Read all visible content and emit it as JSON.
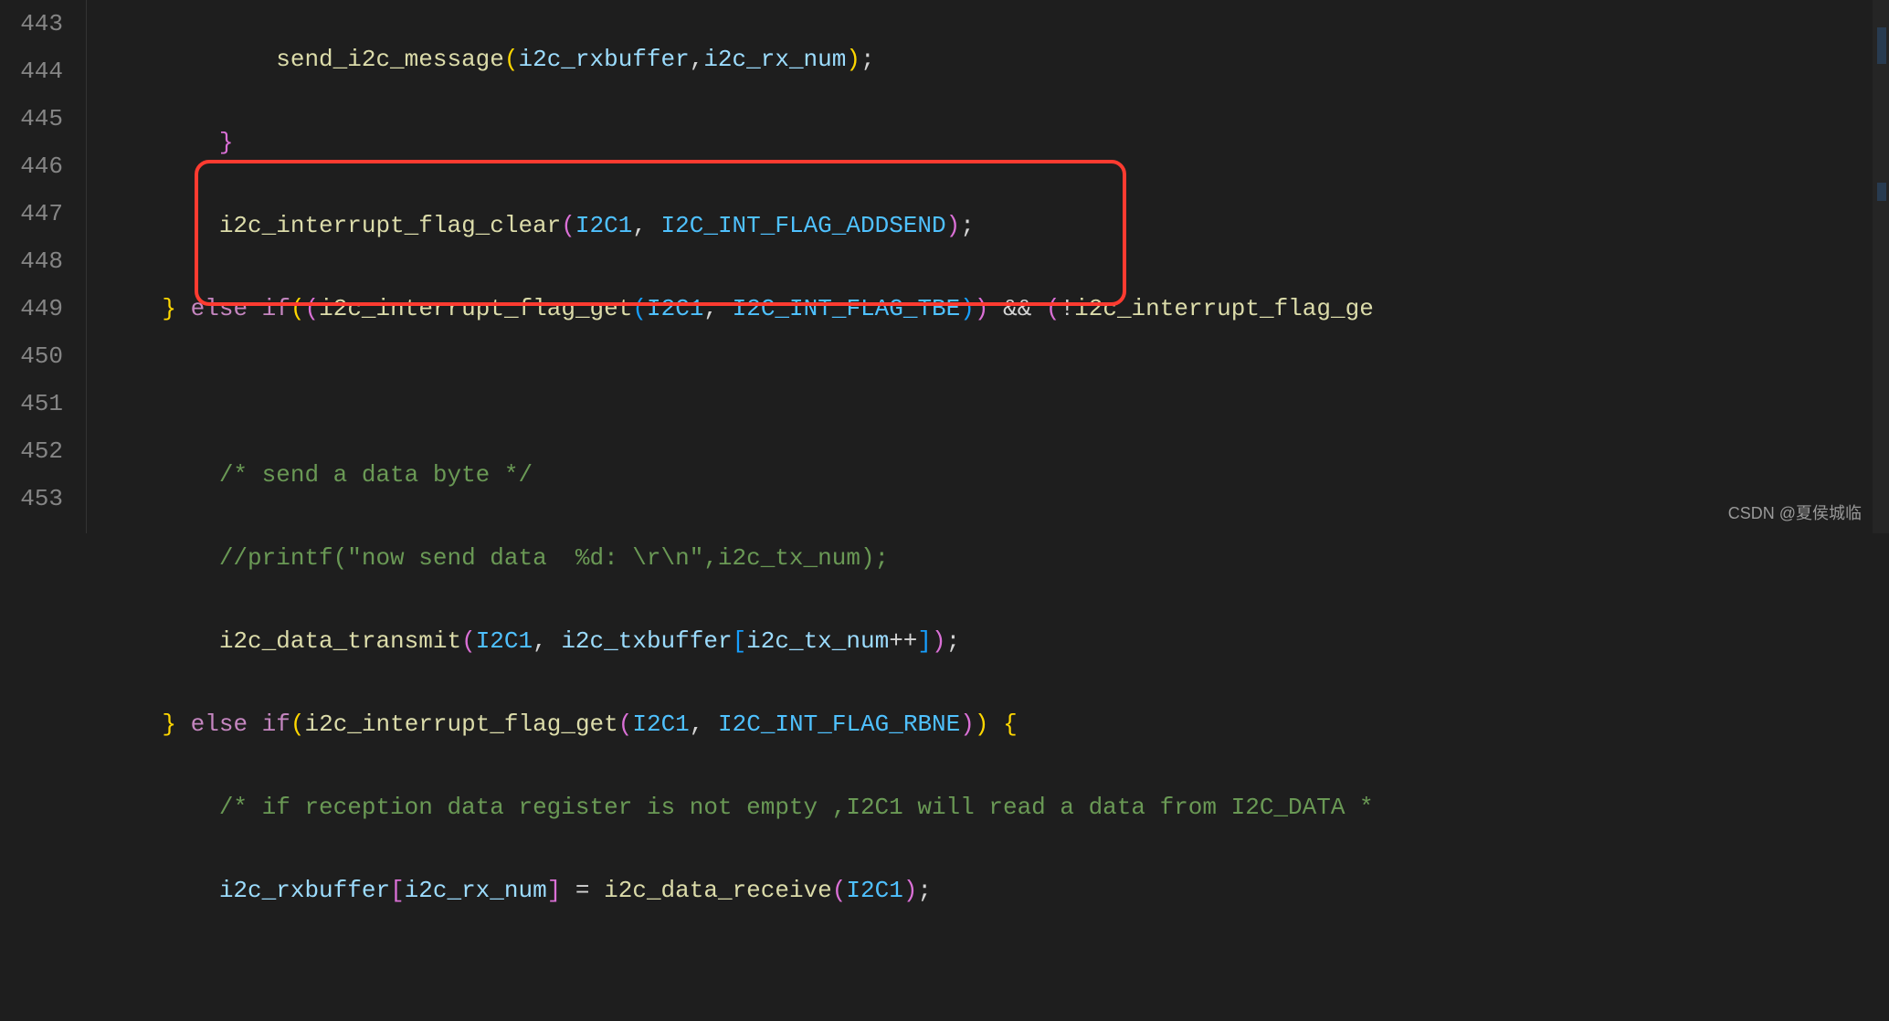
{
  "lines": {
    "443": "443",
    "444": "444",
    "445": "445",
    "446": "446",
    "447": "447",
    "448": "448",
    "449": "449",
    "450": "450",
    "451": "451",
    "452": "452",
    "453": "453"
  },
  "code": {
    "l443_fn": "send_i2c_message",
    "l443_a1": "i2c_rxbuffer",
    "l443_a2": "i2c_rx_num",
    "l445_fn": "i2c_interrupt_flag_clear",
    "l445_a1": "I2C1",
    "l445_a2": "I2C_INT_FLAG_ADDSEND",
    "l446_else": "else",
    "l446_if": "if",
    "l446_fn1": "i2c_interrupt_flag_get",
    "l446_a1": "I2C1",
    "l446_a2": "I2C_INT_FLAG_TBE",
    "l446_fn2": "i2c_interrupt_flag_ge",
    "l448_c": "/* send a data byte */",
    "l449_c": "//printf(\"now send data  %d: \\r\\n\",i2c_tx_num);",
    "l450_fn": "i2c_data_transmit",
    "l450_a1": "I2C1",
    "l450_a2": "i2c_txbuffer",
    "l450_a3": "i2c_tx_num",
    "l451_else": "else",
    "l451_if": "if",
    "l451_fn": "i2c_interrupt_flag_get",
    "l451_a1": "I2C1",
    "l451_a2": "I2C_INT_FLAG_RBNE",
    "l452_c": "/* if reception data register is not empty ,I2C1 will read a data from I2C_DATA *",
    "l453_v1": "i2c_rxbuffer",
    "l453_v2": "i2c_rx_num",
    "l453_fn": "i2c_data_receive",
    "l453_a1": "I2C1"
  },
  "watermark": "CSDN @夏侯城临"
}
